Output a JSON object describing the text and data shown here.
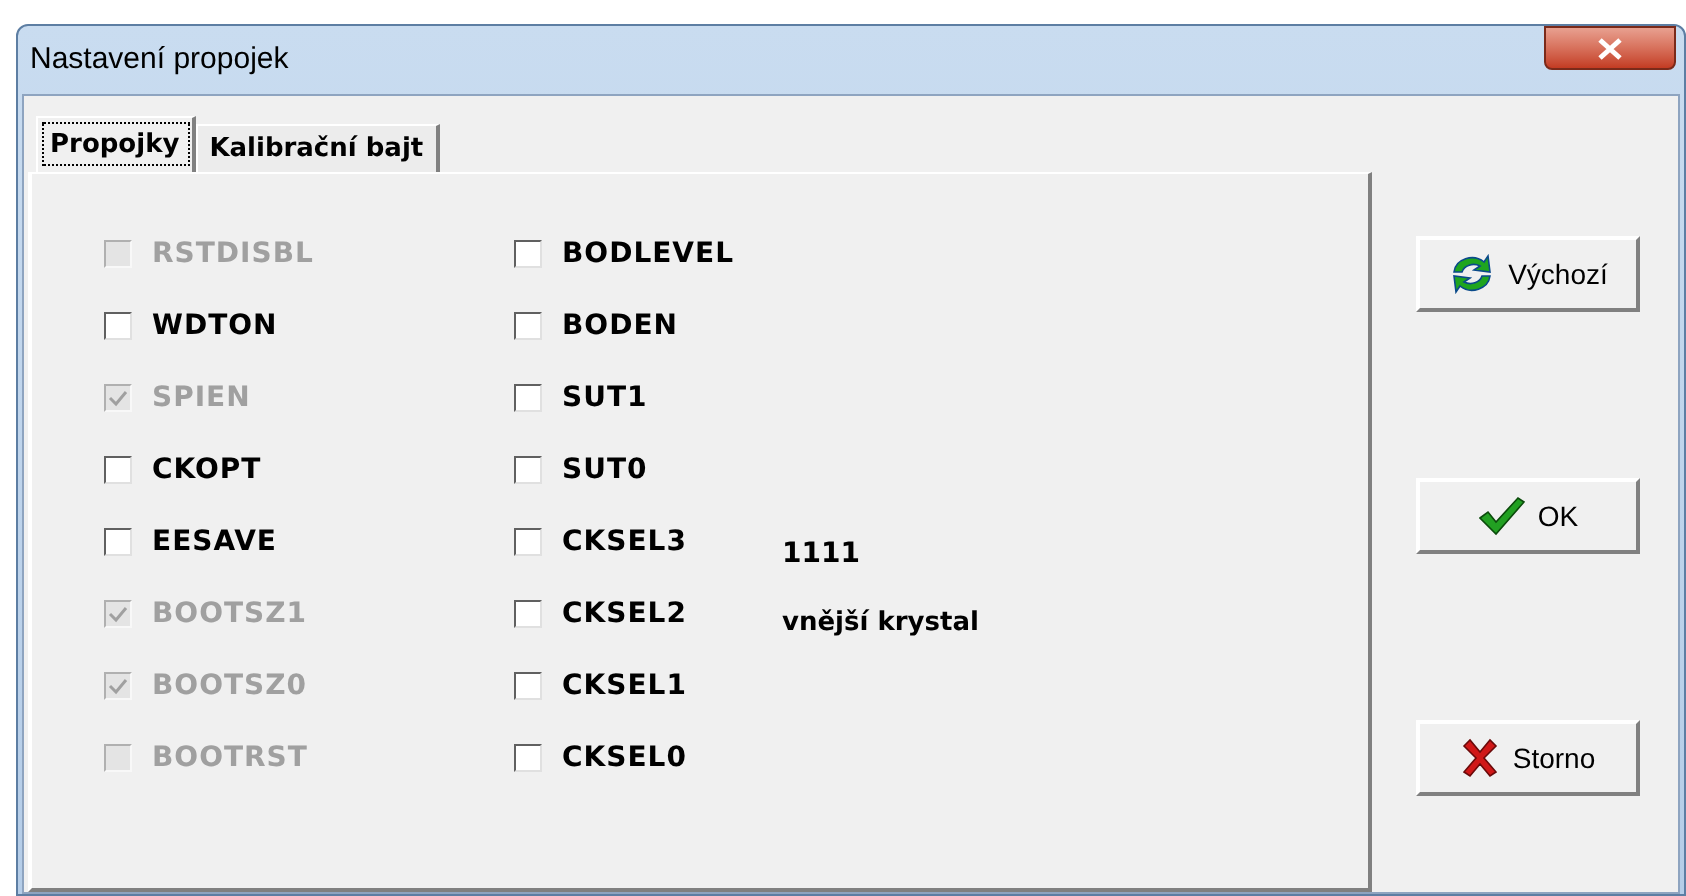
{
  "window": {
    "title": "Nastavení propojek"
  },
  "tabs": [
    {
      "label": "Propojky",
      "selected": true
    },
    {
      "label": "Kalibrační bajt",
      "selected": false
    }
  ],
  "fuses_left": [
    {
      "label": "RSTDISBL",
      "checked": false,
      "disabled": true
    },
    {
      "label": "WDTON",
      "checked": false,
      "disabled": false
    },
    {
      "label": "SPIEN",
      "checked": true,
      "disabled": true
    },
    {
      "label": "CKOPT",
      "checked": false,
      "disabled": false
    },
    {
      "label": "EESAVE",
      "checked": false,
      "disabled": false
    },
    {
      "label": "BOOTSZ1",
      "checked": true,
      "disabled": true
    },
    {
      "label": "BOOTSZ0",
      "checked": true,
      "disabled": true
    },
    {
      "label": "BOOTRST",
      "checked": false,
      "disabled": true
    }
  ],
  "fuses_right": [
    {
      "label": "BODLEVEL",
      "checked": false,
      "disabled": false
    },
    {
      "label": "BODEN",
      "checked": false,
      "disabled": false
    },
    {
      "label": "SUT1",
      "checked": false,
      "disabled": false
    },
    {
      "label": "SUT0",
      "checked": false,
      "disabled": false
    },
    {
      "label": "CKSEL3",
      "checked": false,
      "disabled": false
    },
    {
      "label": "CKSEL2",
      "checked": false,
      "disabled": false
    },
    {
      "label": "CKSEL1",
      "checked": false,
      "disabled": false
    },
    {
      "label": "CKSEL0",
      "checked": false,
      "disabled": false
    }
  ],
  "clock_info": {
    "value": "1111",
    "description": "vnější krystal"
  },
  "buttons": [
    {
      "kind": "default",
      "label": "Výchozí"
    },
    {
      "kind": "ok",
      "label": "OK"
    },
    {
      "kind": "cancel",
      "label": "Storno"
    }
  ]
}
